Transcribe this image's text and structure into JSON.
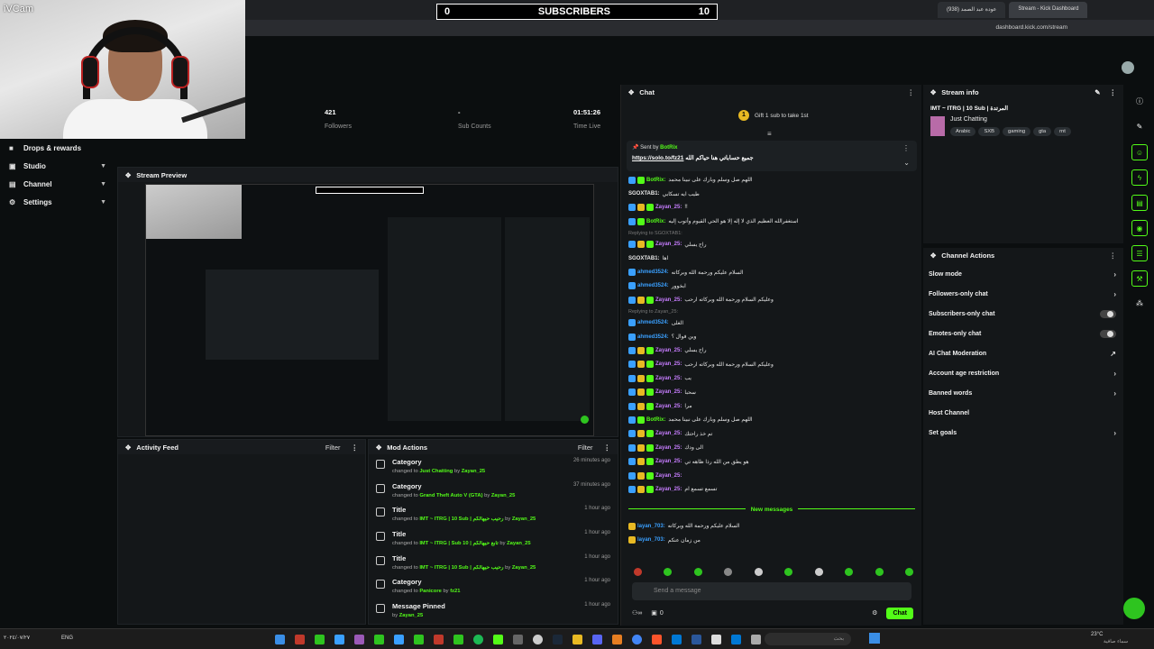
{
  "browser": {
    "tabs": [
      {
        "label": "(938) عودة عبد الصمد"
      },
      {
        "label": "Stream - Kick Dashboard"
      }
    ],
    "url": "dashboard.kick.com/stream"
  },
  "overlay": {
    "cam_label": "iVCam",
    "subscribers_left": "0",
    "subscribers_title": "SUBSCRIBERS",
    "subscribers_right": "10"
  },
  "sidebar": {
    "items": [
      {
        "label": "Drops & rewards",
        "icon": "gift-icon"
      },
      {
        "label": "Studio",
        "icon": "monitor-icon"
      },
      {
        "label": "Channel",
        "icon": "channel-icon"
      },
      {
        "label": "Settings",
        "icon": "gear-icon"
      }
    ]
  },
  "stats": [
    {
      "value": "421",
      "label": "Followers"
    },
    {
      "value": "-",
      "label": "Sub Counts"
    },
    {
      "value": "01:51:26",
      "label": "Time Live"
    }
  ],
  "preview": {
    "title": "Stream Preview"
  },
  "activity": {
    "title": "Activity Feed",
    "filter": "Filter"
  },
  "mod_actions": {
    "title": "Mod Actions",
    "filter": "Filter",
    "rows": [
      {
        "title": "Category",
        "prefix": "changed to",
        "value": "Just Chatting",
        "by": "by",
        "user": "Zayan_25",
        "time": "26 minutes ago"
      },
      {
        "title": "Category",
        "prefix": "changed to",
        "value": "Grand Theft Auto V (GTA)",
        "by": "by",
        "user": "Zayan_25",
        "time": "37 minutes ago"
      },
      {
        "title": "Title",
        "prefix": "changed to",
        "value": "IMT ~ ITRG | 10 Sub | رحيب حيهالكم",
        "by": "by",
        "user": "Zayan_25",
        "time": "1 hour ago"
      },
      {
        "title": "Title",
        "prefix": "changed to",
        "value": "IMT ~ ITRG | Sub 10 | تابع حيهالكم",
        "by": "by",
        "user": "Zayan_25",
        "time": "1 hour ago"
      },
      {
        "title": "Title",
        "prefix": "changed to",
        "value": "IMT ~ ITRG | 10 Sub | رحيب حيهالكم",
        "by": "by",
        "user": "Zayan_25",
        "time": "1 hour ago"
      },
      {
        "title": "Category",
        "prefix": "changed to",
        "value": "Panicore",
        "by": "by",
        "user": "fz21",
        "time": "1 hour ago"
      },
      {
        "title": "Message Pinned",
        "prefix": "by",
        "value": "Zayan_25",
        "by": "",
        "user": "",
        "time": "1 hour ago"
      }
    ]
  },
  "chat": {
    "title": "Chat",
    "gift_count": "1",
    "gift_text": "Gift 1 sub to take 1st",
    "pinned_sent_by": "Sent by",
    "pinned_user": "BotRix",
    "pinned_text": "جميع حساباتي هنا حياكم الله",
    "pinned_link": "https://solo.to/fz21",
    "messages": [
      {
        "user": "BotRix:",
        "text": "اللهم صل وسلم وبارك على نبينا محمد",
        "color": "#53fc18",
        "badges": "b1 b3"
      },
      {
        "user": "SGOXTAB1:",
        "text": "طيب ايه تسكابي",
        "color": "#e8e8e8",
        "badges": ""
      },
      {
        "user": "Zayan_25:",
        "text": "!!",
        "color": "#c77dff",
        "badges": "b1 b2 b3"
      },
      {
        "user": "BotRix:",
        "text": "استغفرالله العظيم الذي لا إله إلا هو الحي القيوم وأتوب إليه",
        "color": "#53fc18",
        "badges": "b1 b3"
      },
      {
        "user": "Zayan_25:",
        "text": "راح يسلي",
        "color": "#c77dff",
        "badges": "b1 b2 b3",
        "reply": "Replying to SGOXTAB1:"
      },
      {
        "user": "SGOXTAB1:",
        "text": "اها",
        "color": "#e8e8e8",
        "badges": ""
      },
      {
        "user": "ahmed3524:",
        "text": "السلام عليكم ورحمة الله وبركاته",
        "color": "#3aa0ff",
        "badges": "b1"
      },
      {
        "user": "ahmed3524:",
        "text": "ابخوور",
        "color": "#3aa0ff",
        "badges": "b1"
      },
      {
        "user": "Zayan_25:",
        "text": "وعليكم السلام ورحمة الله وبركاته ارحب",
        "color": "#c77dff",
        "badges": "b1 b2 b3"
      },
      {
        "user": "ahmed3524:",
        "text": "الغلى",
        "color": "#3aa0ff",
        "badges": "b1",
        "reply": "Replying to Zayan_25:"
      },
      {
        "user": "ahmed3524:",
        "text": "وين فوال ؟",
        "color": "#3aa0ff",
        "badges": "b1"
      },
      {
        "user": "Zayan_25:",
        "text": "راح يسلي",
        "color": "#c77dff",
        "badges": "b1 b2 b3"
      },
      {
        "user": "Zayan_25:",
        "text": "وعليكم السلام ورحمة الله وبركاته ارحب",
        "color": "#c77dff",
        "badges": "b1 b2 b3"
      },
      {
        "user": "Zayan_25:",
        "text": "يب",
        "color": "#c77dff",
        "badges": "b1 b2 b3"
      },
      {
        "user": "Zayan_25:",
        "text": "سحبا",
        "color": "#c77dff",
        "badges": "b1 b2 b3"
      },
      {
        "user": "Zayan_25:",
        "text": "مرا",
        "color": "#c77dff",
        "badges": "b1 b2 b3"
      },
      {
        "user": "BotRix:",
        "text": "اللهم صل وسلم وبارك على نبينا محمد",
        "color": "#53fc18",
        "badges": "b1 b3"
      },
      {
        "user": "Zayan_25:",
        "text": "تم خذ راحتك",
        "color": "#c77dff",
        "badges": "b1 b2 b3"
      },
      {
        "user": "Zayan_25:",
        "text": "الى ودك",
        "color": "#c77dff",
        "badges": "b1 b2 b3"
      },
      {
        "user": "Zayan_25:",
        "text": "هو يطق من الله رذا ظاهه تي",
        "color": "#c77dff",
        "badges": "b1 b2 b3"
      },
      {
        "user": "Zayan_25:",
        "text": "",
        "color": "#c77dff",
        "badges": "b1 b2 b3"
      },
      {
        "user": "Zayan_25:",
        "text": "تسمع تسمع ام",
        "color": "#c77dff",
        "badges": "b1 b2 b3"
      }
    ],
    "new_messages": "New messages",
    "new": [
      {
        "user": "layan_703:",
        "text": "السلام عليكم ورحمة الله وبركاته",
        "color": "#3aa0ff"
      },
      {
        "user": "layan_703:",
        "text": "من زمان عنكم",
        "color": "#3aa0ff"
      }
    ],
    "send_placeholder": "Send a message",
    "footer_count": "0",
    "chat_button": "Chat"
  },
  "stream_info": {
    "title": "Stream info",
    "stream_title": "IMT ~ ITRG | 10 Sub | المرتدة",
    "category": "Just Chatting",
    "tags": [
      "Arabic",
      "SXB",
      "gaming",
      "gta",
      "rnt"
    ]
  },
  "channel_actions": {
    "title": "Channel Actions",
    "rows": [
      {
        "label": "Slow mode",
        "control": "chevron"
      },
      {
        "label": "Followers-only chat",
        "control": "chevron"
      },
      {
        "label": "Subscribers-only chat",
        "control": "toggle"
      },
      {
        "label": "Emotes-only chat",
        "control": "toggle"
      },
      {
        "label": "AI Chat Moderation",
        "control": "link"
      },
      {
        "label": "Account age restriction",
        "control": "chevron"
      },
      {
        "label": "Banned words",
        "control": "chevron"
      },
      {
        "label": "Host Channel",
        "control": "none"
      },
      {
        "label": "Set goals",
        "control": "chevron"
      }
    ]
  },
  "taskbar": {
    "lang": "ENG",
    "search_placeholder": "بحث",
    "temperature": "23°C",
    "weather": "سماء صافية",
    "date": "٢٠٢٤/٠٧/٢٧"
  },
  "colors": {
    "accent": "#53fc18",
    "bg": "#0b0e0f",
    "panel": "#141719"
  }
}
